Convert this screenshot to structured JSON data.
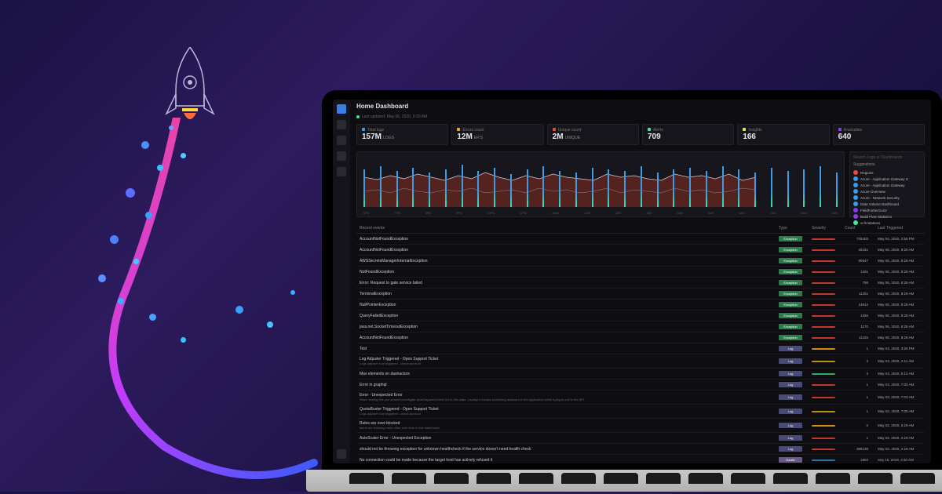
{
  "header": {
    "title": "Home Dashboard",
    "last_updated": "Last updated: May 06, 2020, 9:20 AM"
  },
  "stats": [
    {
      "label": "Total logs",
      "value": "157M",
      "unit": "LOGS",
      "color": "#3b9de8"
    },
    {
      "label": "Errors count",
      "value": "12M",
      "unit": "ER'S",
      "color": "#e8a83b"
    },
    {
      "label": "Unique count",
      "value": "2M",
      "unit": "UNIQUE",
      "color": "#e84b3b"
    },
    {
      "label": "Alerts",
      "value": "709",
      "unit": "",
      "color": "#3be8a8"
    },
    {
      "label": "Insights",
      "value": "166",
      "unit": "",
      "color": "#e8e83b"
    },
    {
      "label": "Anomalies",
      "value": "640",
      "unit": "",
      "color": "#8b3be8"
    }
  ],
  "suggestions": {
    "title": "Suggestions",
    "search_placeholder": "Search Logs or Dashboards",
    "items": [
      {
        "label": "Regions",
        "color": "#e84b3b"
      },
      {
        "label": "Azure - Application Gateway S",
        "color": "#3b9de8"
      },
      {
        "label": "Azure - Application Gateway",
        "color": "#3b9de8"
      },
      {
        "label": "Azure Overview",
        "color": "#3b9de8"
      },
      {
        "label": "Azure - Network Security",
        "color": "#3b9de8"
      },
      {
        "label": "Data Volume Dashboard",
        "color": "#3b9de8"
      },
      {
        "label": "FieldForkerGun2",
        "color": "#8b3be8"
      },
      {
        "label": "Build Flow Statistics",
        "color": "#8b3be8"
      },
      {
        "label": "or limitations",
        "color": "#3be8a8"
      }
    ]
  },
  "chart_data": {
    "type": "bar",
    "bars": [
      48,
      52,
      46,
      50,
      44,
      48,
      54,
      46,
      50,
      42,
      48,
      52,
      46,
      44,
      50,
      48,
      46,
      52,
      44,
      48,
      50,
      46,
      52,
      48,
      44,
      50,
      46,
      48,
      52,
      44
    ],
    "area": [
      38,
      35,
      40,
      36,
      42,
      38,
      34,
      40,
      36,
      44,
      38,
      34,
      40,
      36,
      42,
      38,
      36,
      34,
      42,
      38,
      40,
      36,
      34,
      42,
      38,
      40,
      36,
      42,
      34,
      38
    ],
    "area2": [
      20,
      22,
      18,
      24,
      20,
      18,
      22,
      20,
      24,
      18,
      20,
      22,
      18,
      24,
      20,
      22,
      18,
      20,
      24,
      18,
      22,
      20,
      18,
      24,
      20,
      22,
      18,
      20,
      24,
      22
    ],
    "xlabels": [
      "6PM",
      "7PM",
      "8PM",
      "9PM",
      "10PM",
      "11PM",
      "12AM",
      "1AM",
      "2AM",
      "3AM",
      "4AM",
      "5AM",
      "6AM",
      "7AM",
      "8AM",
      "9AM"
    ]
  },
  "table": {
    "title": "Recent events",
    "columns": [
      "Type",
      "Severity",
      "Count",
      "Last Triggered"
    ],
    "rows": [
      {
        "name": "AccountNotFoundException",
        "type": "Exception",
        "severity": "red",
        "count": "705183",
        "time": "May 04, 2020, 2:55 PM"
      },
      {
        "name": "AccountNotFoundException",
        "type": "Exception",
        "severity": "red",
        "count": "35181",
        "time": "May 06, 2020, 9:20 AM"
      },
      {
        "name": "AWSSecretsManagerInternalException",
        "type": "Exception",
        "severity": "red",
        "count": "80647",
        "time": "May 06, 2020, 8:29 AM"
      },
      {
        "name": "NotFoundException",
        "type": "Exception",
        "severity": "red",
        "count": "1401",
        "time": "May 06, 2020, 8:29 AM"
      },
      {
        "name": "Error: Request to gate service failed",
        "type": "Exception",
        "severity": "red",
        "count": "798",
        "time": "May 06, 2020, 8:29 AM"
      },
      {
        "name": "TerminalException",
        "type": "Exception",
        "severity": "red",
        "count": "11251",
        "time": "May 06, 2020, 8:29 AM"
      },
      {
        "name": "NullPointerException",
        "type": "Exception",
        "severity": "red",
        "count": "14814",
        "time": "May 06, 2020, 8:28 AM"
      },
      {
        "name": "QueryFailedException",
        "type": "Exception",
        "severity": "red",
        "count": "1255",
        "time": "May 06, 2020, 8:28 AM"
      },
      {
        "name": "java.net.SocketTimeoutException",
        "type": "Exception",
        "severity": "red",
        "count": "1170",
        "time": "May 06, 2020, 8:28 AM"
      },
      {
        "name": "AccountNotFoundException",
        "type": "Exception",
        "severity": "red",
        "count": "11425",
        "time": "May 06, 2020, 8:28 AM"
      },
      {
        "name": "Test",
        "type": "Log",
        "severity": "orange",
        "count": "1",
        "time": "May 04, 2020, 3:26 PM"
      },
      {
        "name": "Log Adjuster Triggered - Open Support Ticket",
        "sub": "Logs adjuster rule triggered - check account",
        "type": "Log",
        "severity": "yellow",
        "count": "3",
        "time": "May 04, 2020, 2:11 AM"
      },
      {
        "name": "Max elements on dashactors",
        "type": "Log",
        "severity": "green",
        "count": "3",
        "time": "May 04, 2020, 8:14 AM"
      },
      {
        "name": "Error in graphql",
        "type": "Log",
        "severity": "red",
        "count": "1",
        "time": "May 04, 2020, 7:04 AM"
      },
      {
        "name": "Error - Unexpected Error",
        "sub": "When seeing this you should investigate what happened that led to this state. Usually it means something awkward in the application while trying to call to the API",
        "type": "Log",
        "severity": "red",
        "count": "1",
        "time": "May 03, 2020, 7:03 AM"
      },
      {
        "name": "QuotaBuster Triggered - Open Support Ticket",
        "sub": "Logs adjuster rule triggered - check account",
        "type": "Log",
        "severity": "yellow",
        "count": "1",
        "time": "May 02, 2020, 7:00 AM"
      },
      {
        "name": "Rules are over-blocked",
        "sub": "alerts are blocking each other over time in this dashboard",
        "type": "Log",
        "severity": "orange",
        "count": "2",
        "time": "May 02, 2020, 6:29 AM"
      },
      {
        "name": "AutoScaler Error - Unexpected Exception",
        "type": "Log",
        "severity": "red",
        "count": "1",
        "time": "May 02, 2020, 2:19 AM"
      },
      {
        "name": "should not be throwing exception for unknown healthcheck if the service doesn't need health check",
        "type": "Log",
        "severity": "red",
        "count": "385139",
        "time": "May 02, 2020, 2:18 AM"
      },
      {
        "name": "No connection could be made because the target host has actively refused it",
        "type": "Health",
        "severity": "blue",
        "count": "1804",
        "time": "Sep 16, 2019, 4:40 AM"
      }
    ]
  },
  "sidebar": {
    "items": [
      "home",
      "search",
      "logs",
      "alerts",
      "dashboards",
      "settings"
    ]
  }
}
